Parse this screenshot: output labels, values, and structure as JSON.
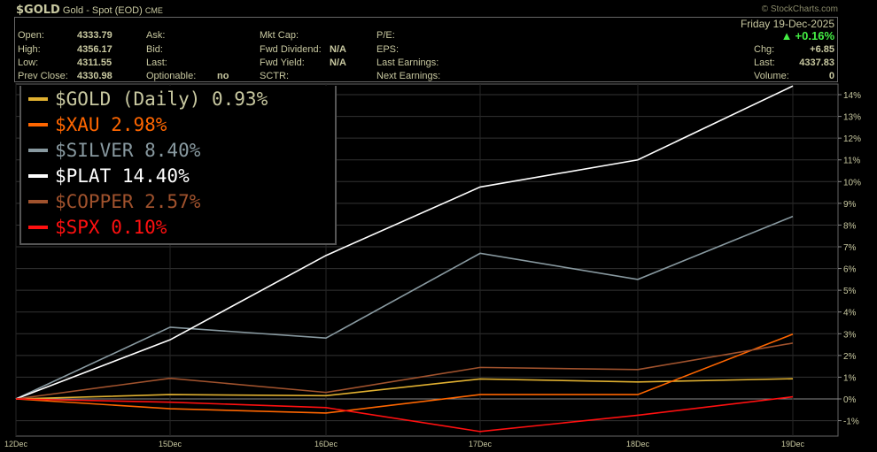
{
  "header": {
    "symbol": "$GOLD",
    "name": "Gold - Spot (EOD)",
    "exchange": "CME",
    "watermark": "© StockCharts.com",
    "open_label": "Open:",
    "open": "4333.79",
    "high_label": "High:",
    "high": "4356.17",
    "low_label": "Low:",
    "low": "4311.55",
    "prev_label": "Prev Close:",
    "prev": "4330.98",
    "ask_label": "Ask:",
    "bid_label": "Bid:",
    "last_label": "Last:",
    "opt_label": "Optionable:",
    "opt": "no",
    "mktcap_label": "Mkt Cap:",
    "fwddiv_label": "Fwd Dividend:",
    "fwddiv": "N/A",
    "fwdyield_label": "Fwd Yield:",
    "fwdyield": "N/A",
    "sctr_label": "SCTR:",
    "pe_label": "P/E:",
    "eps_label": "EPS:",
    "lastearn_label": "Last Earnings:",
    "nextearn_label": "Next Earnings:",
    "date": "Friday  19-Dec-2025",
    "change_pct": "+0.16%",
    "chg_label": "Chg:",
    "chg": "+6.85",
    "last2_label": "Last:",
    "last": "4337.83",
    "vol_label": "Volume:",
    "vol": "0"
  },
  "chart_data": {
    "type": "line",
    "title": "$GOLD (Daily) 0.93%",
    "ylabel": "%",
    "ylim": [
      -1.7,
      14.5
    ],
    "categories": [
      "12Dec",
      "15Dec",
      "16Dec",
      "17Dec",
      "18Dec",
      "19Dec"
    ],
    "yticks": [
      "-1%",
      "0%",
      "1%",
      "2%",
      "3%",
      "4%",
      "5%",
      "6%",
      "7%",
      "8%",
      "9%",
      "10%",
      "11%",
      "12%",
      "13%",
      "14%"
    ],
    "series": [
      {
        "name": "$GOLD (Daily)",
        "label": "$GOLD (Daily) 0.93%",
        "color": "#e0b030",
        "text_color": "#c8c8a0",
        "values": [
          0,
          0.2,
          0.15,
          0.92,
          0.78,
          0.93
        ]
      },
      {
        "name": "$XAU",
        "label": "$XAU 2.98%",
        "color": "#ff6600",
        "values": [
          0,
          -0.45,
          -0.65,
          0.2,
          0.2,
          2.98
        ]
      },
      {
        "name": "$SILVER",
        "label": "$SILVER 8.40%",
        "color": "#8899a0",
        "values": [
          0,
          3.3,
          2.8,
          6.7,
          5.5,
          8.4
        ]
      },
      {
        "name": "$PLAT",
        "label": "$PLAT 14.40%",
        "color": "#ffffff",
        "values": [
          0,
          2.72,
          6.6,
          9.75,
          11.0,
          14.4
        ]
      },
      {
        "name": "$COPPER",
        "label": "$COPPER 2.57%",
        "color": "#a0522d",
        "values": [
          0,
          0.95,
          0.3,
          1.45,
          1.35,
          2.57
        ]
      },
      {
        "name": "$SPX",
        "label": "$SPX 0.10%",
        "color": "#ff1010",
        "values": [
          0,
          -0.15,
          -0.4,
          -1.5,
          -0.75,
          0.1
        ]
      }
    ]
  }
}
